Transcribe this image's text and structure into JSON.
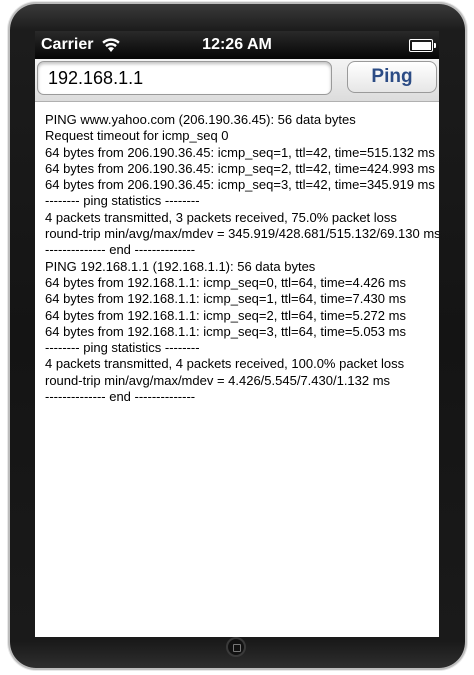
{
  "status_bar": {
    "carrier": "Carrier",
    "time": "12:26 AM"
  },
  "toolbar": {
    "host_value": "192.168.1.1",
    "ping_label": "Ping"
  },
  "output": {
    "lines": [
      "PING www.yahoo.com (206.190.36.45): 56 data bytes",
      "Request timeout for icmp_seq 0",
      "64 bytes from 206.190.36.45: icmp_seq=1, ttl=42, time=515.132 ms",
      "64 bytes from 206.190.36.45: icmp_seq=2, ttl=42, time=424.993 ms",
      "64 bytes from 206.190.36.45: icmp_seq=3, ttl=42, time=345.919 ms",
      "-------- ping statistics --------",
      "4 packets transmitted, 3 packets received, 75.0% packet loss",
      "round-trip min/avg/max/mdev = 345.919/428.681/515.132/69.130 ms",
      "-------------- end --------------",
      "PING 192.168.1.1 (192.168.1.1): 56 data bytes",
      "64 bytes from 192.168.1.1: icmp_seq=0, ttl=64, time=4.426 ms",
      "64 bytes from 192.168.1.1: icmp_seq=1, ttl=64, time=7.430 ms",
      "64 bytes from 192.168.1.1: icmp_seq=2, ttl=64, time=5.272 ms",
      "64 bytes from 192.168.1.1: icmp_seq=3, ttl=64, time=5.053 ms",
      "-------- ping statistics --------",
      "4 packets transmitted, 4 packets received, 100.0% packet loss",
      "round-trip min/avg/max/mdev = 4.426/5.545/7.430/1.132 ms",
      "-------------- end --------------"
    ]
  },
  "icons": {
    "wifi": "wifi-icon",
    "battery": "battery-icon",
    "home": "home-button-icon"
  },
  "colors": {
    "ping_button_text": "#2c4c85",
    "status_bar_bg": "#050505",
    "toolbar_bg": "#dcdcdc"
  }
}
